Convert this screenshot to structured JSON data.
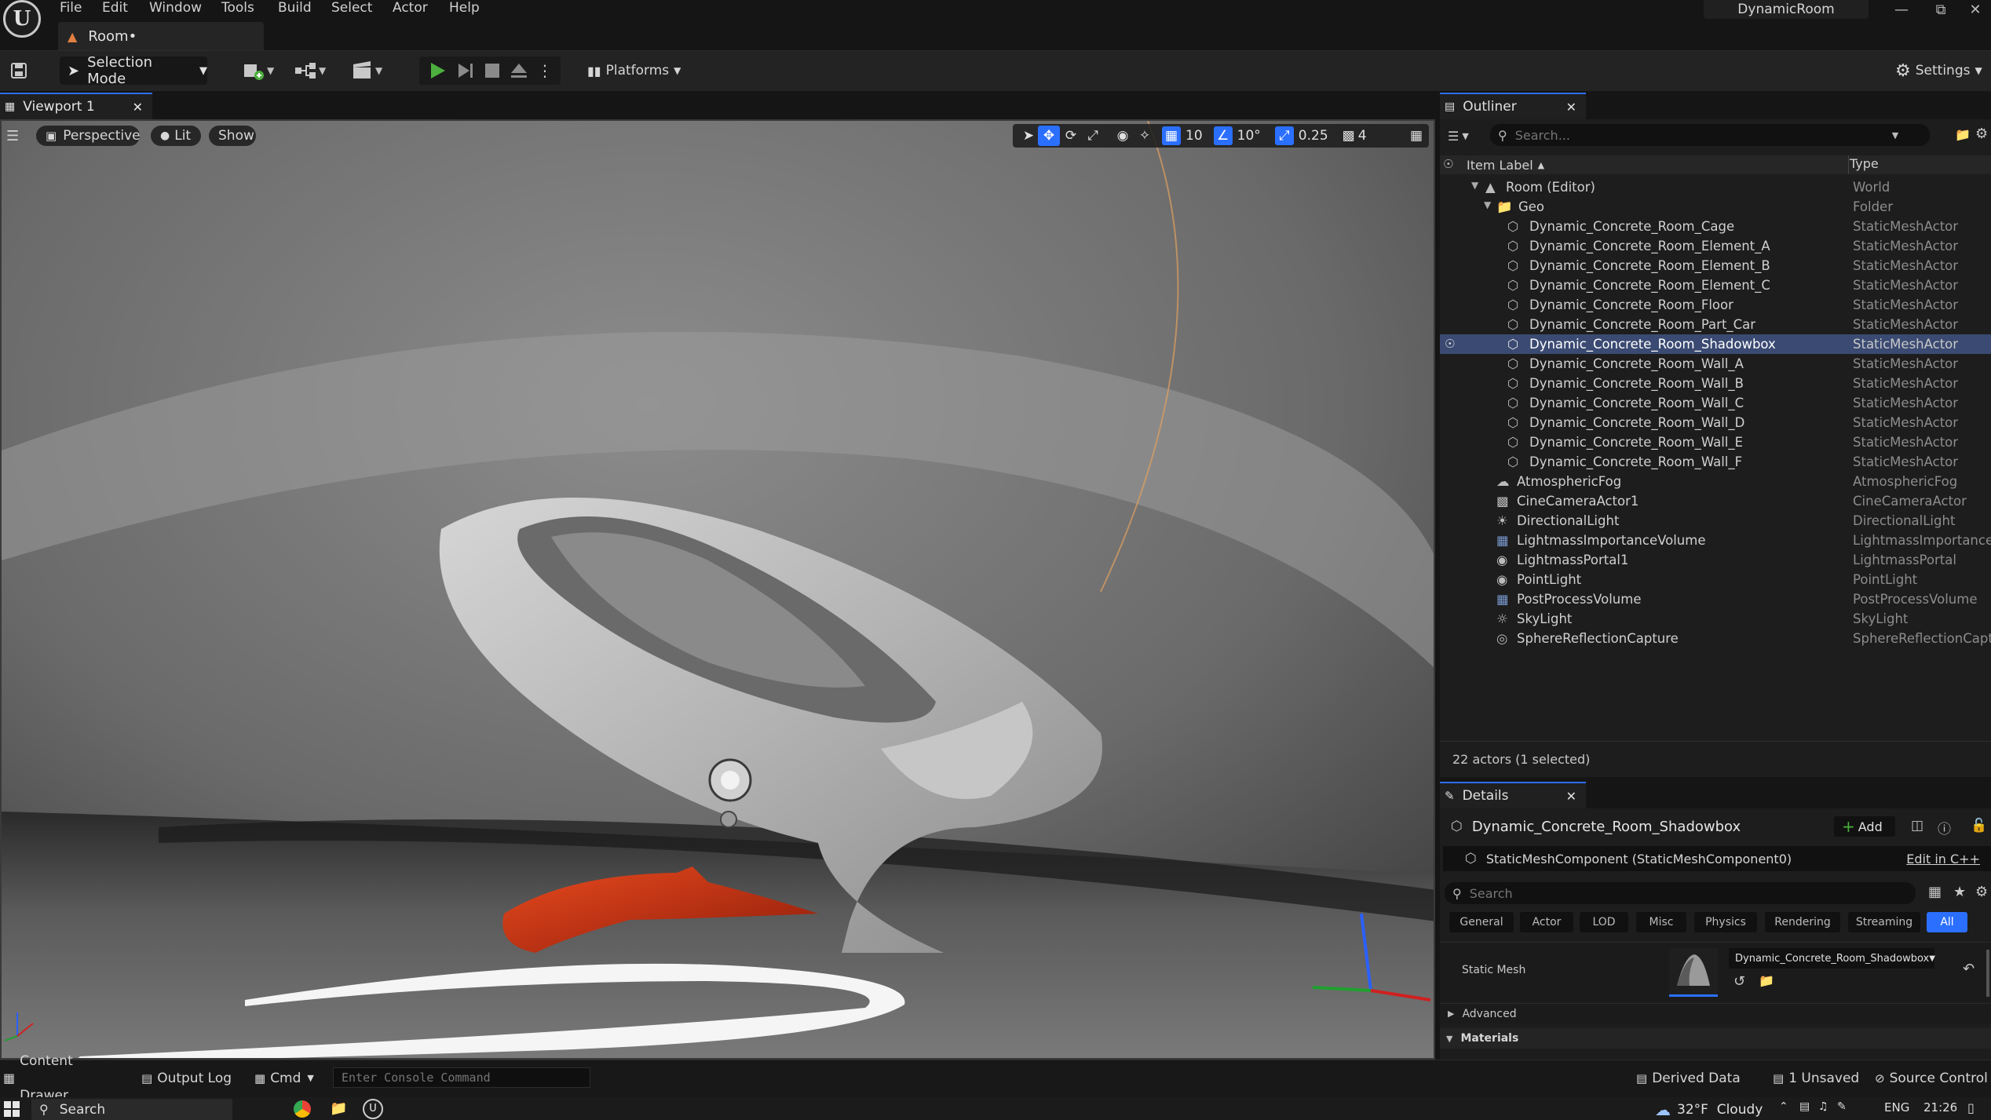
{
  "menubar": {
    "items": [
      "File",
      "Edit",
      "Window",
      "Tools",
      "Build",
      "Select",
      "Actor",
      "Help"
    ],
    "project_name": "DynamicRoom",
    "document_tab": "Room•"
  },
  "toolbar": {
    "selection_mode": "Selection Mode",
    "platforms": "Platforms",
    "settings": "Settings"
  },
  "viewport": {
    "tab_label": "Viewport 1",
    "perspective": "Perspective",
    "lit": "Lit",
    "show": "Show",
    "grid_snap": "10",
    "rotation_snap": "10°",
    "scale_snap": "0.25",
    "camera_speed": "4"
  },
  "outliner": {
    "tab_label": "Outliner",
    "search_placeholder": "Search...",
    "col_label": "Item Label",
    "col_type": "Type",
    "rows": [
      {
        "label": "Room (Editor)",
        "type": "World"
      },
      {
        "label": "Geo",
        "type": "Folder"
      },
      {
        "label": "Dynamic_Concrete_Room_Cage",
        "type": "StaticMeshActor"
      },
      {
        "label": "Dynamic_Concrete_Room_Element_A",
        "type": "StaticMeshActor"
      },
      {
        "label": "Dynamic_Concrete_Room_Element_B",
        "type": "StaticMeshActor"
      },
      {
        "label": "Dynamic_Concrete_Room_Element_C",
        "type": "StaticMeshActor"
      },
      {
        "label": "Dynamic_Concrete_Room_Floor",
        "type": "StaticMeshActor"
      },
      {
        "label": "Dynamic_Concrete_Room_Part_Car",
        "type": "StaticMeshActor"
      },
      {
        "label": "Dynamic_Concrete_Room_Shadowbox",
        "type": "StaticMeshActor"
      },
      {
        "label": "Dynamic_Concrete_Room_Wall_A",
        "type": "StaticMeshActor"
      },
      {
        "label": "Dynamic_Concrete_Room_Wall_B",
        "type": "StaticMeshActor"
      },
      {
        "label": "Dynamic_Concrete_Room_Wall_C",
        "type": "StaticMeshActor"
      },
      {
        "label": "Dynamic_Concrete_Room_Wall_D",
        "type": "StaticMeshActor"
      },
      {
        "label": "Dynamic_Concrete_Room_Wall_E",
        "type": "StaticMeshActor"
      },
      {
        "label": "Dynamic_Concrete_Room_Wall_F",
        "type": "StaticMeshActor"
      },
      {
        "label": "AtmosphericFog",
        "type": "AtmosphericFog"
      },
      {
        "label": "CineCameraActor1",
        "type": "CineCameraActor"
      },
      {
        "label": "DirectionalLight",
        "type": "DirectionalLight"
      },
      {
        "label": "LightmassImportanceVolume",
        "type": "LightmassImportanceVolume"
      },
      {
        "label": "LightmassPortal1",
        "type": "LightmassPortal"
      },
      {
        "label": "PointLight",
        "type": "PointLight"
      },
      {
        "label": "PostProcessVolume",
        "type": "PostProcessVolume"
      },
      {
        "label": "SkyLight",
        "type": "SkyLight"
      },
      {
        "label": "SphereReflectionCapture",
        "type": "SphereReflectionCapture"
      }
    ],
    "actor_count": "22 actors (1 selected)"
  },
  "details": {
    "tab_label": "Details",
    "actor_name": "Dynamic_Concrete_Room_Shadowbox",
    "add_label": "Add",
    "component": "StaticMeshComponent (StaticMeshComponent0)",
    "edit_cpp": "Edit in C++",
    "search_placeholder": "Search",
    "categories": [
      "General",
      "Actor",
      "LOD",
      "Misc",
      "Physics",
      "Rendering",
      "Streaming",
      "All"
    ],
    "static_mesh_label": "Static Mesh",
    "static_mesh_value": "Dynamic_Concrete_Room_Shadowbox",
    "advanced": "Advanced",
    "materials": "Materials"
  },
  "statusbar": {
    "content_drawer": "Content Drawer",
    "output_log": "Output Log",
    "cmd": "Cmd",
    "console_placeholder": "Enter Console Command",
    "derived_data": "Derived Data",
    "unsaved": "1 Unsaved",
    "source_control": "Source Control"
  },
  "taskbar": {
    "search": "Search",
    "weather": "32°F  Cloudy",
    "lang": "ENG",
    "time": "21:26"
  },
  "colors": {
    "accent": "#2b6fff",
    "selected_row": "#3a4a72",
    "play_green": "#4caf3e"
  }
}
